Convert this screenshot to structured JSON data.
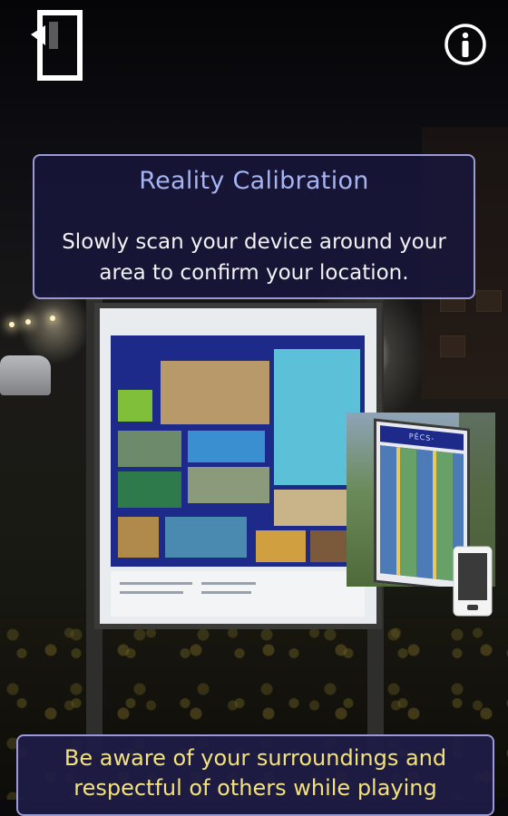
{
  "calibration": {
    "title": "Reality Calibration",
    "message": "Slowly scan your device around your area to confirm your location."
  },
  "warning": {
    "message": "Be aware of your surroundings and respectful of others while playing"
  },
  "icons": {
    "exit": "exit-door-icon",
    "info": "info-icon",
    "phone": "phone-icon"
  },
  "thumbnail": {
    "sign_text": "PÉCS-PILISBOROSJENŐ"
  },
  "colors": {
    "panel_bg": "#18163a",
    "panel_border": "#9b9ad6",
    "title_color": "#a6b4f2",
    "warning_text": "#f3e27a"
  }
}
